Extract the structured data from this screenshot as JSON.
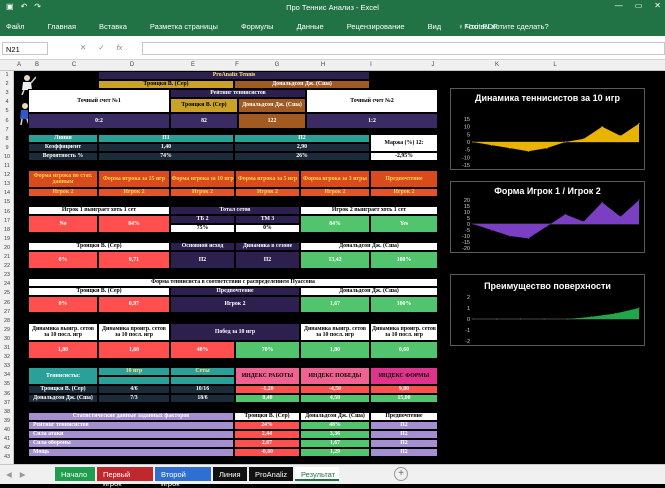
{
  "window": {
    "title": "Про Теннис Анализ - Excel",
    "min": "—",
    "max": "▭",
    "close": "✕"
  },
  "ribbon": {
    "tabs": [
      "Файл",
      "Главная",
      "Вставка",
      "Разметка страницы",
      "Формулы",
      "Данные",
      "Рецензирование",
      "Вид",
      "Foxit PDF"
    ],
    "tell_me": "Что вы хотите сделать?"
  },
  "formula": {
    "namebox": "N21",
    "fx": "fx",
    "cancel": "✕",
    "enter": "✓"
  },
  "cols": [
    "A",
    "B",
    "C",
    "D",
    "E",
    "F",
    "G",
    "H",
    "I",
    "J",
    "K",
    "L"
  ],
  "rows": [
    "1",
    "2",
    "3",
    "4",
    "5",
    "6",
    "7",
    "8",
    "9",
    "10",
    "11",
    "12",
    "13",
    "14",
    "15",
    "16",
    "17",
    "18",
    "19",
    "20",
    "21",
    "22",
    "23",
    "24",
    "25",
    "26",
    "27",
    "28",
    "29",
    "30",
    "31",
    "32",
    "33",
    "34",
    "35",
    "36",
    "37",
    "38",
    "39",
    "40",
    "41",
    "42",
    "43"
  ],
  "header": {
    "app": "ProAnaliz Tennis",
    "p1": "Троицки В. (Сер)",
    "p2": "Дональдсон Дж. (Сша)"
  },
  "exact": {
    "l1": "Точный счет №1",
    "l2": "Точный счет №2",
    "rank_hdr": "Рейтинг теннисистов",
    "v1": "0:2",
    "r1": "82",
    "r2": "122",
    "v2": "1:2"
  },
  "line": {
    "lbl_line": "Линия",
    "lbl_coef": "Коэффициент",
    "lbl_prob": "Вероятность %",
    "p1": "П1",
    "p2": "П2",
    "c1": "1,40",
    "c2": "2,90",
    "pr1": "74%",
    "pr2": "26%",
    "marza": "Маржа (%) 12:",
    "mv": "-2,95%"
  },
  "form": {
    "h": [
      "Форма игрока по стат. данным",
      "Форма игрока за 15 игр",
      "Форма игрока за 10 игр",
      "Форма игрока за 5 игр",
      "Форма игрока за 3 игры",
      "Предпочтение"
    ],
    "v": [
      "Игрок 2",
      "Игрок 2",
      "Игрок 2",
      "Игрок 2",
      "Игрок 2",
      "Игрок 2"
    ]
  },
  "set": {
    "l1": "Игрок 1 выиграет хоть 1 сет",
    "l2": "Тотал сетов",
    "l3": "Игрок 2 выиграет хоть 1 сет",
    "no": "No",
    "pct1": "84%",
    "tb2": "ТБ 2",
    "tm3": "ТМ 3",
    "tbv": "75%",
    "tmv": "0%",
    "pct2": "84%",
    "yes": "Yes"
  },
  "main": {
    "p1": "Троицки В. (Сер)",
    "outcome": "Основной исход",
    "dyn": "Динамика в сезоне",
    "p2": "Дональдсон Дж. (Сша)",
    "a": "0%",
    "b": "0,71",
    "c": "П2",
    "d": "П2",
    "e": "13,42",
    "f": "100%"
  },
  "poisson": {
    "title": "Форма теннисиста в соответствии с распределением Пуассона",
    "p1": "Троицки В. (Сер)",
    "pref": "Предпочтение",
    "p2": "Дональдсон Дж. (Сша)",
    "a": "0%",
    "b": "0,97",
    "c": "Игрок 2",
    "d": "1,67",
    "e": "100%"
  },
  "dyn10": {
    "h1": "Динамика выигр. сетов за 10 посл. игр",
    "h2": "Динамика проигр. сетов за 10 посл. игр",
    "h3": "Побед за 10 игр",
    "h4": "Динамика выигр. сетов за 10 посл. игр",
    "h5": "Динамика проигр. сетов за 10 посл. игр",
    "a": "1,80",
    "b": "1,60",
    "c": "40%",
    "d": "70%",
    "e": "1,80",
    "f": "0,60"
  },
  "stats": {
    "tennis": "Теннисисты:",
    "g10": "10 игр",
    "sets": "Сеты",
    "slash": "/",
    "p1": "Троицки В. (Сер)",
    "p2": "Дональдсон Дж. (Сша)",
    "w1": "4/6",
    "s1": "10/16",
    "w2": "7/3",
    "s2": "18/6",
    "ir": "ИНДЕКС РАБОТЫ",
    "ip": "ИНДЕКС ПОБЕДЫ",
    "if": "ИНДЕКС ФОРМЫ",
    "ir1": "-1,20",
    "ir2": "0,40",
    "ip1": "-4,50",
    "ip2": "4,50",
    "if1": "9,00",
    "if2": "15,00"
  },
  "factors": {
    "title": "Статистические данные заданных факторов",
    "p1": "Троицки В. (Сер)",
    "p2": "Дональдсон Дж. (Сша)",
    "pref": "Предпочтение",
    "rows": [
      {
        "name": "Рейтинг теннисистов",
        "a": "24%",
        "b": "48%",
        "p": "П2"
      },
      {
        "name": "Сила атаки",
        "a": "2,44",
        "b": "3,36",
        "p": "П2"
      },
      {
        "name": "Сила обороны",
        "a": "2,67",
        "b": "1,67",
        "p": "П2"
      },
      {
        "name": "Мощь",
        "a": "-0,60",
        "b": "1,29",
        "p": "П2"
      }
    ]
  },
  "charts": [
    {
      "title": "Динамика теннисистов за 10 игр",
      "yticks": [
        "15",
        "10",
        "5",
        "0",
        "-5",
        "-10",
        "-15"
      ]
    },
    {
      "title": "Форма Игрок 1 / Игрок 2",
      "yticks": [
        "20",
        "15",
        "10",
        "5",
        "0",
        "-5",
        "-10",
        "-15",
        "-20"
      ]
    },
    {
      "title": "Преимущество поверхности",
      "yticks": [
        "2",
        "1",
        "0",
        "-1",
        "-2"
      ]
    }
  ],
  "chart_data": [
    {
      "type": "area",
      "title": "Динамика теннисистов за 10 игр",
      "x": [
        1,
        2,
        3,
        4,
        5,
        6,
        7,
        8,
        9,
        10
      ],
      "values": [
        0,
        -2,
        -4,
        -6,
        -4,
        0,
        2,
        10,
        4,
        12
      ],
      "ylim": [
        -15,
        15
      ],
      "color": "#e8b400"
    },
    {
      "type": "area",
      "title": "Форма Игрок 1 / Игрок 2",
      "x": [
        1,
        2,
        3,
        4,
        5,
        6,
        7,
        8,
        9,
        10
      ],
      "values": [
        0,
        -5,
        -10,
        -12,
        -2,
        8,
        2,
        18,
        6,
        20
      ],
      "ylim": [
        -20,
        20
      ],
      "color": "#7b3fc4"
    },
    {
      "type": "area",
      "title": "Преимущество поверхности",
      "x": [
        1,
        2,
        3,
        4,
        5,
        6,
        7,
        8
      ],
      "values": [
        0,
        0,
        0,
        0,
        0,
        0.2,
        0.5,
        1
      ],
      "ylim": [
        -2,
        2
      ],
      "color": "#1fa84a"
    }
  ],
  "sheets": [
    {
      "name": "Начало",
      "color": "#1f9e4f"
    },
    {
      "name": "Первый игрок",
      "color": "#c0282d"
    },
    {
      "name": "Второй игрок",
      "color": "#2f6fd1"
    },
    {
      "name": "Линия",
      "color": "#111"
    },
    {
      "name": "ProAnaliz",
      "color": "#111"
    },
    {
      "name": "Результат",
      "color": "#fff"
    }
  ],
  "add_sheet": "+"
}
